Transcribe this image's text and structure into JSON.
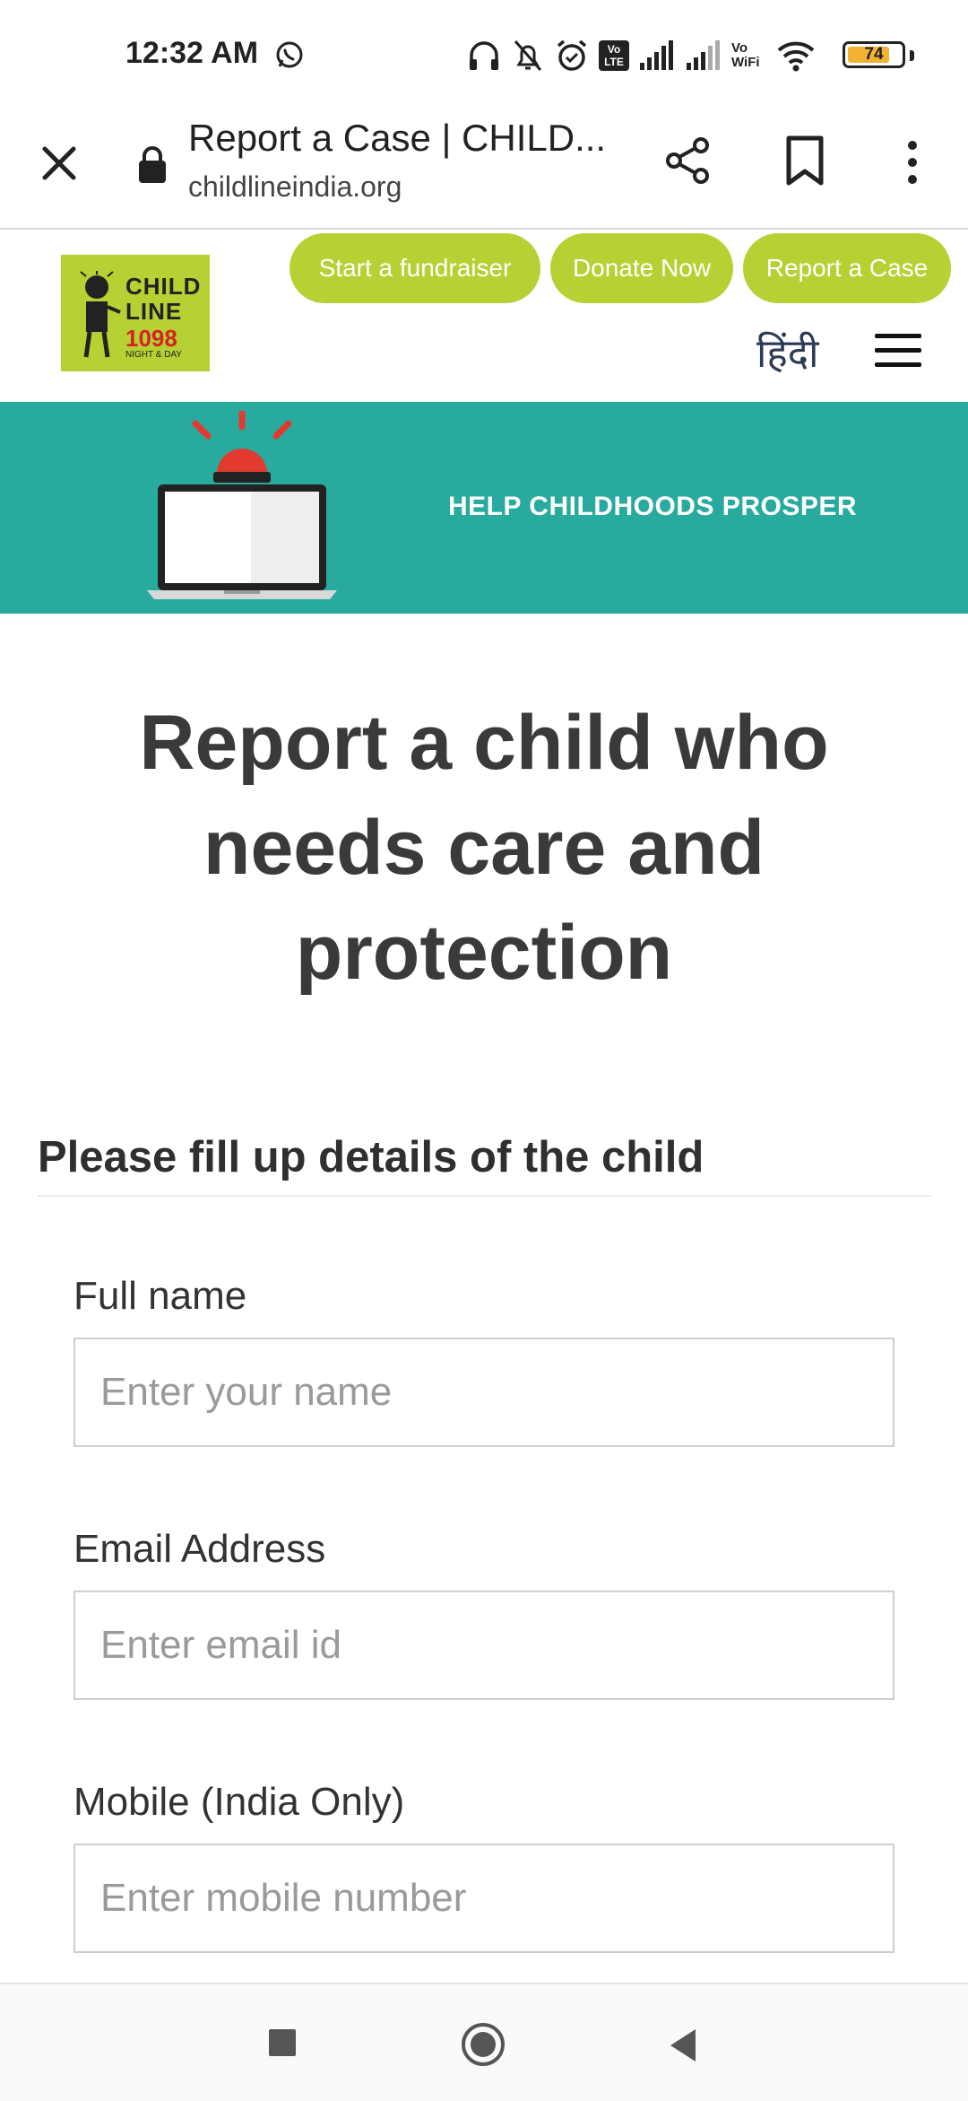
{
  "status_bar": {
    "time": "12:32 AM",
    "battery": "74",
    "icons": [
      "whatsapp-icon",
      "headphones-icon",
      "bell-off-icon",
      "alarm-icon",
      "volte-icon",
      "signal-icon",
      "signal-icon",
      "vowifi-icon",
      "wifi-icon",
      "battery-icon"
    ],
    "vowifi_label": "Vo WiFi",
    "volte_label": "Vo LTE"
  },
  "browser": {
    "title": "Report a Case | CHILD...",
    "url": "childlineindia.org",
    "icons": [
      "close-icon",
      "lock-icon",
      "share-icon",
      "bookmark-icon",
      "overflow-menu-icon"
    ]
  },
  "site_header": {
    "logo": {
      "line1": "CHILD",
      "line2": "LINE",
      "number": "1098",
      "tagline": "NIGHT & DAY"
    },
    "buttons": {
      "fundraiser": "Start a fundraiser",
      "donate": "Donate Now",
      "report": "Report a Case"
    },
    "language_link": "हिंदी"
  },
  "banner": {
    "text": "HELP CHILDHOODS PROSPER"
  },
  "main": {
    "title": "Report a child who needs care and protection",
    "section_title": "Please fill up details of the child",
    "fields": [
      {
        "label": "Full name",
        "placeholder": "Enter your name"
      },
      {
        "label": "Email Address",
        "placeholder": "Enter email id"
      },
      {
        "label": "Mobile (India Only)",
        "placeholder": "Enter mobile number"
      }
    ]
  },
  "colors": {
    "brand_green": "#b5d133",
    "banner_teal": "#29aa9f",
    "alarm_red": "#e23a2e",
    "logo_red": "#d42323"
  }
}
